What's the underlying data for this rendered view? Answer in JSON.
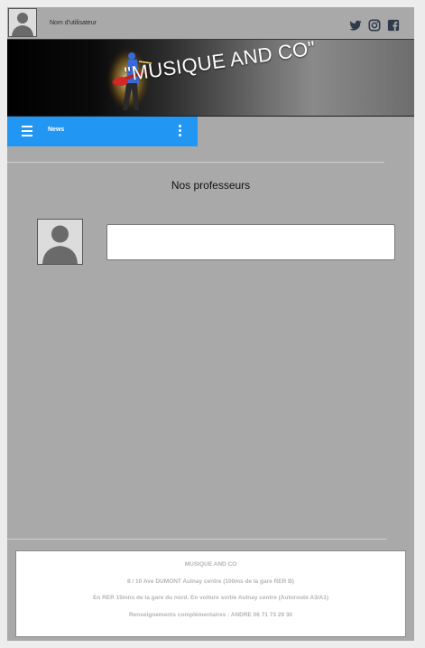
{
  "header": {
    "username": "Nom d'utilisateur",
    "social_icons": [
      "twitter-icon",
      "instagram-icon",
      "facebook-icon"
    ]
  },
  "banner": {
    "title": "\"MUSIQUE AND CO\""
  },
  "navbar": {
    "label": "News",
    "color": "#2196f3"
  },
  "main": {
    "section_title": "Nos professeurs"
  },
  "footer": {
    "line1": "MUSIQUE AND CO",
    "line2": "8 / 10  Ave DUMONT Aulnay centre (100ms de la gare RER B)",
    "line3": "En RER 15mns de la gare du nord. En voiture  sortie Aulnay centre (Autoroute A3/A1)",
    "line4": "Renseignements complémentaires : ANDRE 06 71 73 29 30"
  },
  "colors": {
    "page_background": "#a9a9a9",
    "accent": "#2196f3"
  }
}
